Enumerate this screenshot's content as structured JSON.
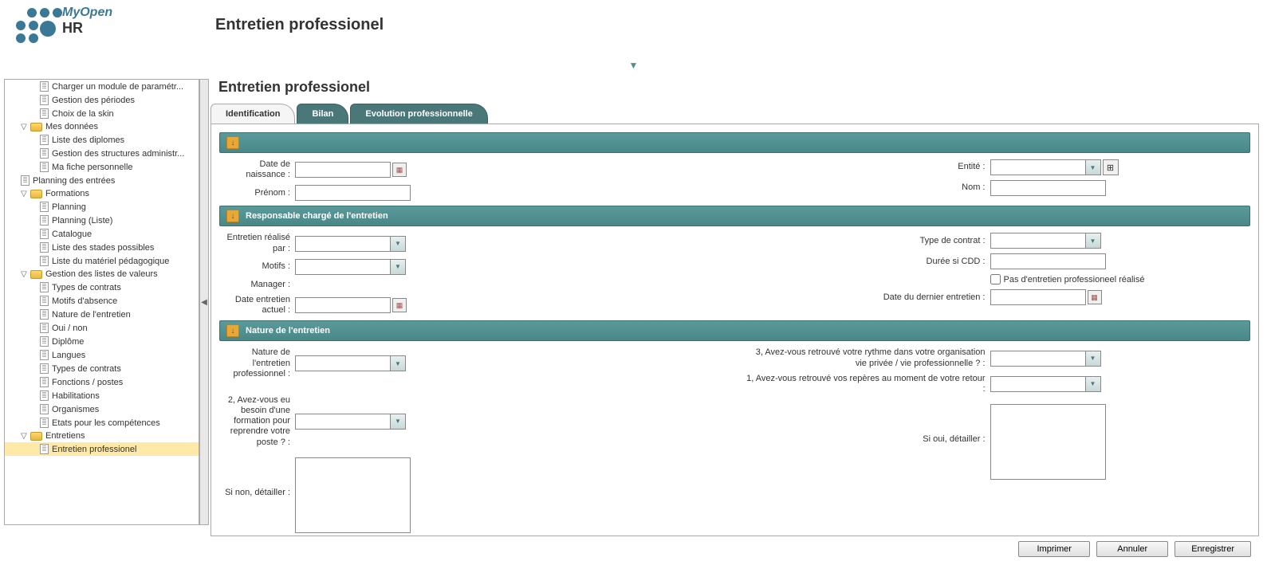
{
  "logo": {
    "line1": "MyOpen",
    "line2": "HR"
  },
  "pageTitle": "Entretien professionel",
  "subTitle": "Entretien professionel",
  "tabs": [
    {
      "label": "Identification",
      "active": true
    },
    {
      "label": "Bilan",
      "active": false
    },
    {
      "label": "Evolution professionnelle",
      "active": false
    }
  ],
  "sidebar": [
    {
      "label": "Charger un module de paramétr...",
      "indent": 2,
      "type": "file"
    },
    {
      "label": "Gestion des périodes",
      "indent": 2,
      "type": "file"
    },
    {
      "label": "Choix de la skin",
      "indent": 2,
      "type": "file"
    },
    {
      "label": "Mes données",
      "indent": 1,
      "type": "folder",
      "expanded": true
    },
    {
      "label": "Liste des diplomes",
      "indent": 2,
      "type": "file"
    },
    {
      "label": "Gestion des structures administr...",
      "indent": 2,
      "type": "file"
    },
    {
      "label": "Ma fiche personnelle",
      "indent": 2,
      "type": "file"
    },
    {
      "label": "Planning des entrées",
      "indent": 1,
      "type": "file"
    },
    {
      "label": "Formations",
      "indent": 1,
      "type": "folder",
      "expanded": true
    },
    {
      "label": "Planning",
      "indent": 2,
      "type": "file"
    },
    {
      "label": "Planning (Liste)",
      "indent": 2,
      "type": "file"
    },
    {
      "label": "Catalogue",
      "indent": 2,
      "type": "file"
    },
    {
      "label": "Liste des stades possibles",
      "indent": 2,
      "type": "file"
    },
    {
      "label": "Liste du matériel pédagogique",
      "indent": 2,
      "type": "file"
    },
    {
      "label": "Gestion des listes de valeurs",
      "indent": 1,
      "type": "folder",
      "expanded": true
    },
    {
      "label": "Types de contrats",
      "indent": 2,
      "type": "file"
    },
    {
      "label": "Motifs d'absence",
      "indent": 2,
      "type": "file"
    },
    {
      "label": "Nature de l'entretien",
      "indent": 2,
      "type": "file"
    },
    {
      "label": "Oui / non",
      "indent": 2,
      "type": "file"
    },
    {
      "label": "Diplôme",
      "indent": 2,
      "type": "file"
    },
    {
      "label": "Langues",
      "indent": 2,
      "type": "file"
    },
    {
      "label": "Types de contrats",
      "indent": 2,
      "type": "file"
    },
    {
      "label": "Fonctions / postes",
      "indent": 2,
      "type": "file"
    },
    {
      "label": "Habilitations",
      "indent": 2,
      "type": "file"
    },
    {
      "label": "Organismes",
      "indent": 2,
      "type": "file"
    },
    {
      "label": "Etats pour les compétences",
      "indent": 2,
      "type": "file"
    },
    {
      "label": "Entretiens",
      "indent": 1,
      "type": "folder",
      "expanded": true
    },
    {
      "label": "Entretien professionel",
      "indent": 2,
      "type": "file",
      "selected": true
    }
  ],
  "sections": {
    "s1": {
      "title": ""
    },
    "s2": {
      "title": "Responsable chargé de l'entretien"
    },
    "s3": {
      "title": "Nature de l'entretien"
    }
  },
  "fields": {
    "dateNaissance": "Date de naissance :",
    "prenom": "Prénom :",
    "entite": "Entité :",
    "nom": "Nom :",
    "entretienRealisePar": "Entretien réalisé par :",
    "motifs": "Motifs :",
    "manager": "Manager :",
    "dateEntretienActuel": "Date entretien actuel :",
    "typeContrat": "Type de contrat :",
    "dureeSiCDD": "Durée si CDD :",
    "pasEntretien": "Pas d'entretien professioneel réalisé",
    "dateDernierEntretien": "Date du dernier entretien :",
    "natureEntretien": "Nature de l'entretien professionnel :",
    "q3": "3, Avez-vous retrouvé votre rythme dans votre organisation vie privée / vie professionnelle ? :",
    "q2": "2, Avez-vous eu besoin d'une formation pour reprendre votre poste ? :",
    "q1": "1, Avez-vous retrouvé vos repères au moment de votre retour :",
    "siNonDetailler": "Si non, détailler :",
    "siOuiDetailler": "Si oui, détailler :"
  },
  "buttons": {
    "imprimer": "Imprimer",
    "annuler": "Annuler",
    "enregistrer": "Enregistrer"
  }
}
